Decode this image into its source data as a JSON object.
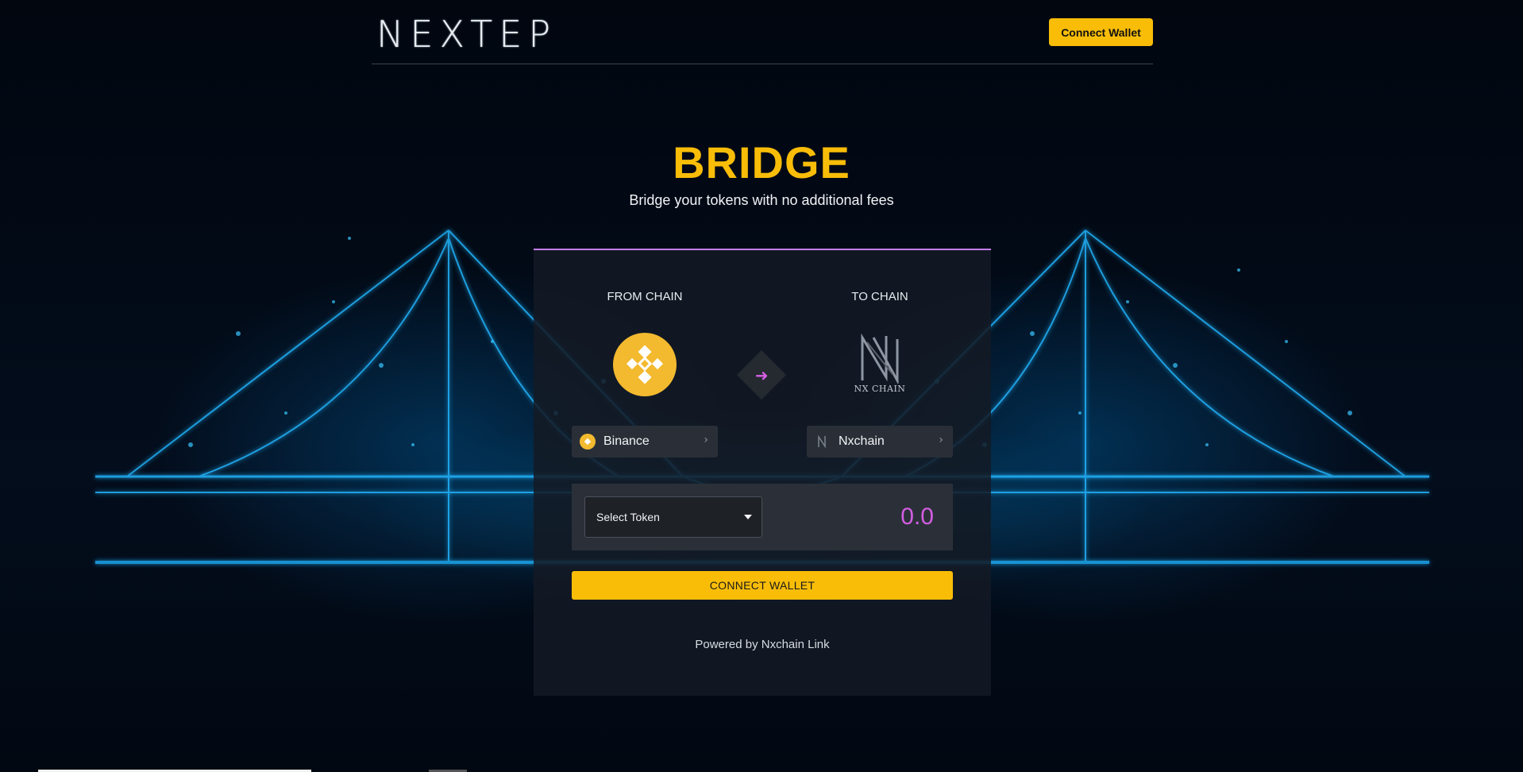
{
  "header": {
    "logo_text": "NEXTEP",
    "connect_wallet_label": "Connect Wallet"
  },
  "hero": {
    "title": "BRIDGE",
    "subtitle": "Bridge your tokens with no additional fees"
  },
  "bridge": {
    "from_label": "FROM CHAIN",
    "to_label": "TO CHAIN",
    "from_chain": "Binance",
    "to_chain": "Nxchain",
    "to_logo_text": "NX CHAIN",
    "token_select_label": "Select Token",
    "amount_placeholder": "0.0",
    "connect_wallet_label": "CONNECT WALLET",
    "powered_prefix": "Powered by",
    "powered_link": "Nxchain Link"
  },
  "colors": {
    "accent": "#f9bd08",
    "highlight": "#d25ee0",
    "card_border": "#c77ef0"
  },
  "icons": [
    "binance-icon",
    "nxchain-icon",
    "arrow-right-icon",
    "chevron-right-icon",
    "caret-down-icon"
  ]
}
